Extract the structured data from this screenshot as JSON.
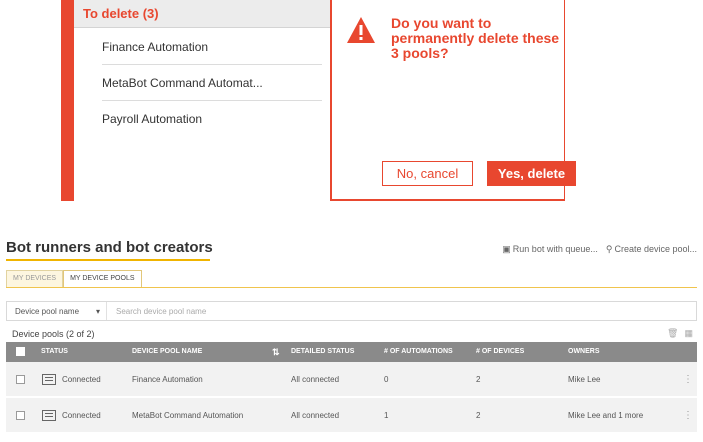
{
  "dialog": {
    "list_header": "To delete (3)",
    "items": [
      "Finance Automation",
      "MetaBot Command Automat...",
      "Payroll Automation"
    ],
    "message": "Do you want to permanently delete these 3 pools?",
    "cancel_label": "No, cancel",
    "confirm_label": "Yes, delete",
    "accent_color": "#e8472f"
  },
  "page": {
    "title": "Bot runners and bot creators",
    "actions": [
      {
        "icon": "run-bot-icon",
        "label": "Run bot with queue..."
      },
      {
        "icon": "search-icon",
        "label": "Create device pool..."
      }
    ]
  },
  "tabs": [
    {
      "label": "MY DEVICES",
      "active": false
    },
    {
      "label": "MY DEVICE POOLS",
      "active": true
    }
  ],
  "filter": {
    "select_value": "Device pool name",
    "search_placeholder": "Search device pool name"
  },
  "table": {
    "count_label": "Device pools (2 of 2)",
    "columns": [
      "STATUS",
      "DEVICE POOL NAME",
      "DETAILED STATUS",
      "# OF AUTOMATIONS",
      "# OF DEVICES",
      "OWNERS"
    ],
    "rows": [
      {
        "status": "Connected",
        "name": "Finance Automation",
        "detailed_status": "All connected",
        "automations": "0",
        "devices": "2",
        "owners": "Mike Lee"
      },
      {
        "status": "Connected",
        "name": "MetaBot Command Automation",
        "detailed_status": "All connected",
        "automations": "1",
        "devices": "2",
        "owners": "Mike Lee and 1 more"
      }
    ]
  }
}
